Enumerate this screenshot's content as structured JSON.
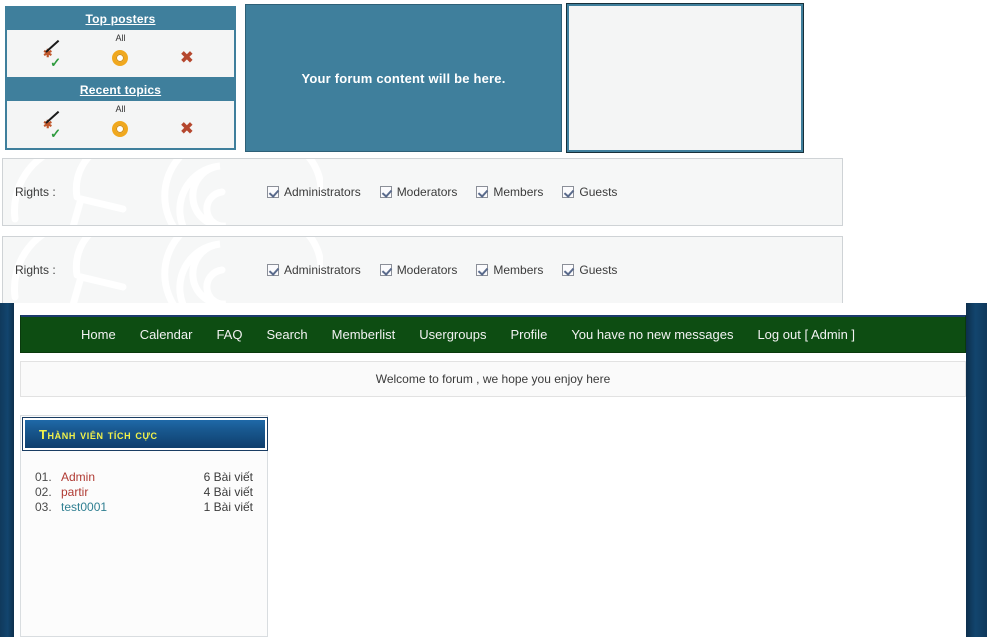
{
  "widgets": [
    {
      "title": "Top posters",
      "scope": "All",
      "icons": [
        {
          "name": "edit-check-icon",
          "glyph": ""
        },
        {
          "name": "gear-icon",
          "glyph": ""
        },
        {
          "name": "delete-x-icon",
          "glyph": "✖"
        }
      ]
    },
    {
      "title": "Recent topics",
      "scope": "All",
      "icons": [
        {
          "name": "edit-check-icon",
          "glyph": ""
        },
        {
          "name": "gear-icon",
          "glyph": ""
        },
        {
          "name": "delete-x-icon",
          "glyph": "✖"
        }
      ]
    }
  ],
  "forum_preview": {
    "text": "Your forum content will be here.",
    "bg_color": "#3f7f9c"
  },
  "empty_panel": {
    "text": "",
    "border_color": "#3f7f9c"
  },
  "rights_rows": [
    {
      "label": "Rights :",
      "options": [
        {
          "label": "Administrators",
          "checked": true
        },
        {
          "label": "Moderators",
          "checked": true
        },
        {
          "label": "Members",
          "checked": true
        },
        {
          "label": "Guests",
          "checked": true
        }
      ]
    },
    {
      "label": "Rights :",
      "options": [
        {
          "label": "Administrators",
          "checked": true
        },
        {
          "label": "Moderators",
          "checked": true
        },
        {
          "label": "Members",
          "checked": true
        },
        {
          "label": "Guests",
          "checked": true
        }
      ]
    }
  ],
  "forum": {
    "nav": [
      {
        "label": "Home"
      },
      {
        "label": "Calendar"
      },
      {
        "label": "FAQ"
      },
      {
        "label": "Search"
      },
      {
        "label": "Memberlist"
      },
      {
        "label": "Usergroups"
      },
      {
        "label": "Profile"
      },
      {
        "label": "You have no new messages"
      },
      {
        "label": "Log out [ Admin ]"
      }
    ],
    "nav_bg_color": "#0d4d12",
    "welcome": "Welcome to forum , we hope you enjoy here",
    "members_block": {
      "title": "Thành viên tích cực",
      "title_color": "#f2f24a",
      "rows": [
        {
          "rank": "01.",
          "name": "Admin",
          "posts": "6 Bài viết",
          "color": "red"
        },
        {
          "rank": "02.",
          "name": "partir",
          "posts": "4 Bài viết",
          "color": "red"
        },
        {
          "rank": "03.",
          "name": "test0001",
          "posts": "1 Bài viết",
          "color": "teal"
        }
      ]
    }
  }
}
